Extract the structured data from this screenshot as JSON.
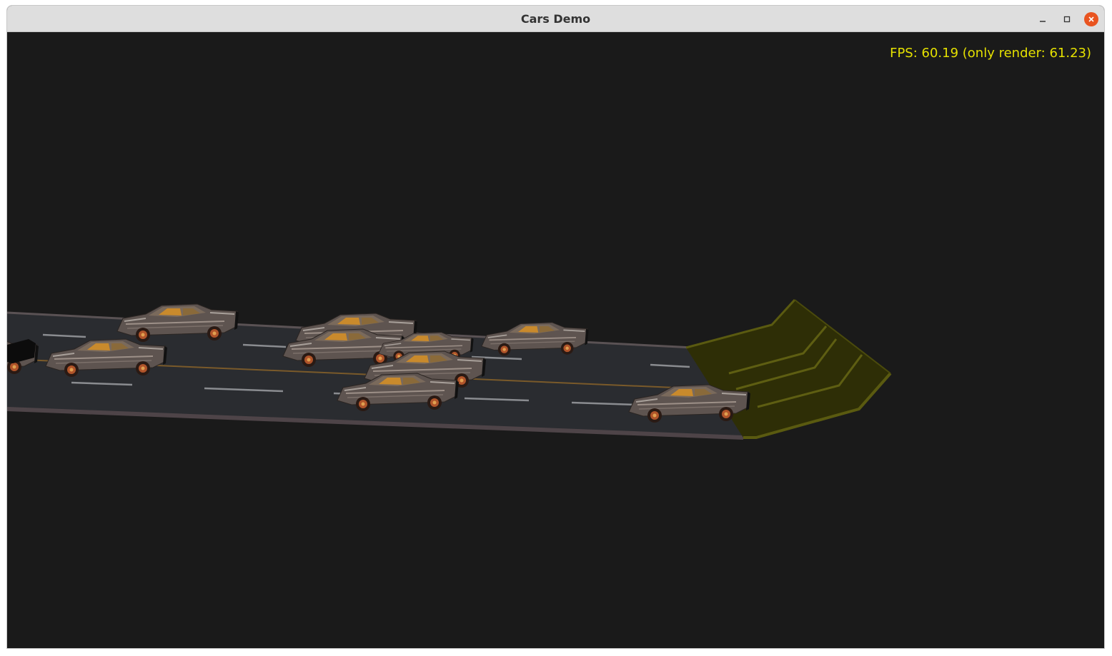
{
  "window": {
    "title": "Cars Demo"
  },
  "hud": {
    "fps_label": "FPS: 60.19 (only render: 61.23)"
  },
  "scene": {
    "background_color": "#1a1a1a",
    "road_color": "#2a2c30",
    "ramp_color": "#2e2e06",
    "ramp_edge_color": "#5a5a10",
    "car_count": 10
  },
  "icons": {
    "minimize": "minimize-icon",
    "maximize": "maximize-icon",
    "close": "close-icon"
  }
}
